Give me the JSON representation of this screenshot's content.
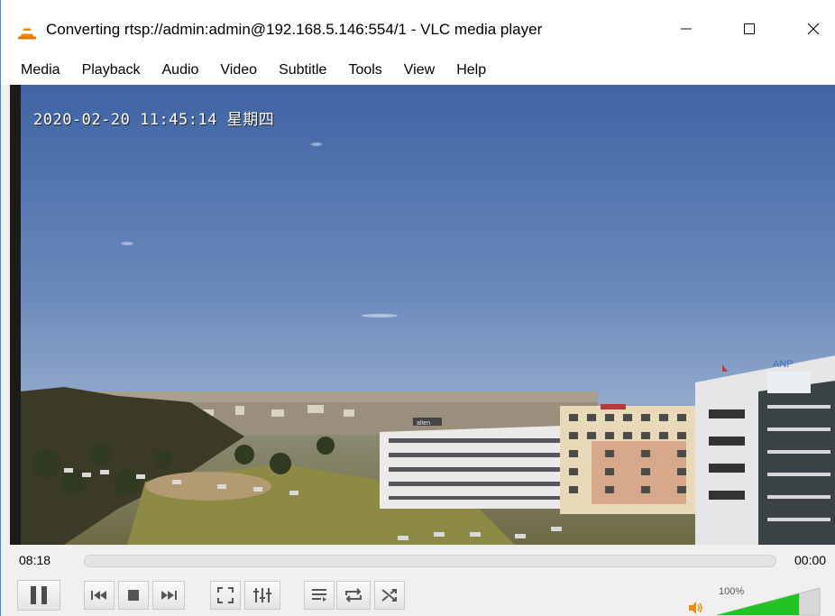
{
  "window": {
    "title": "Converting rtsp://admin:admin@192.168.5.146:554/1 - VLC media player",
    "app_icon": "vlc-cone-icon",
    "controls": [
      "minimize-icon",
      "maximize-icon",
      "close-icon"
    ]
  },
  "menu": {
    "items": [
      "Media",
      "Playback",
      "Audio",
      "Video",
      "Subtitle",
      "Tools",
      "View",
      "Help"
    ]
  },
  "video": {
    "osd_timestamp": "2020-02-20 11:45:14 星期四",
    "signs": {
      "left_building": "alten",
      "right_building": "ANP"
    }
  },
  "seekbar": {
    "elapsed": "08:18",
    "total": "00:00",
    "progress": 0.0
  },
  "controls": {
    "buttons": [
      "pause-icon",
      "previous-icon",
      "stop-icon",
      "next-icon",
      "fullscreen-icon",
      "extended-settings-icon",
      "playlist-icon",
      "loop-icon",
      "random-icon"
    ],
    "volume_label": "100%",
    "volume_level": 1.0
  },
  "colors": {
    "accent": "#3c8dd6",
    "volume_green": "#22c322",
    "vlc_orange": "#f08a00"
  }
}
